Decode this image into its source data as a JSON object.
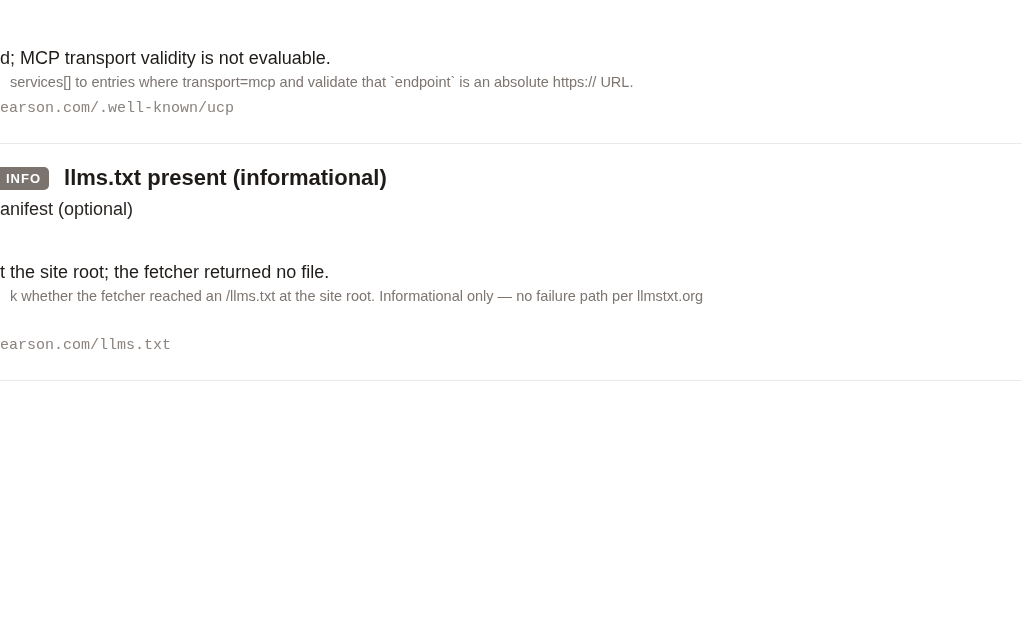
{
  "checks": [
    {
      "detail": "d; MCP transport validity is not evaluable.",
      "hint": "services[] to entries where transport=mcp and validate that `endpoint` is an absolute https:// URL.",
      "url": "earson.com/.well-known/ucp"
    },
    {
      "badge": {
        "label": "INFO",
        "kind": "info"
      },
      "title": "llms.txt present (informational)",
      "subtitle": "anifest (optional)",
      "detail": "t the site root; the fetcher returned no file.",
      "hint": "k whether the fetcher reached an /llms.txt at the site root. Informational only — no failure path per llmstxt.org",
      "url": "earson.com/llms.txt"
    }
  ]
}
